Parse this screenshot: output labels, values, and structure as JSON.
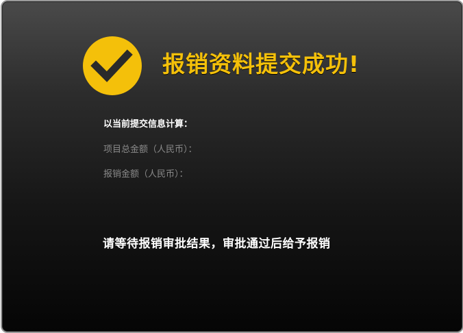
{
  "colors": {
    "accent": "#f4c00a",
    "checkmark": "#2a2a2a",
    "label_gray": "#8a8a8a",
    "text_white": "#ffffff"
  },
  "icon": {
    "name": "checkmark-circle-icon"
  },
  "title": {
    "text": "报销资料提交成功",
    "punct": "!"
  },
  "info": {
    "heading": "以当前提交信息计算：",
    "rows": [
      {
        "label": "项目总金额（人民币）："
      },
      {
        "label": "报销金额（人民币）："
      }
    ]
  },
  "notice": "请等待报销审批结果，审批通过后给予报销"
}
